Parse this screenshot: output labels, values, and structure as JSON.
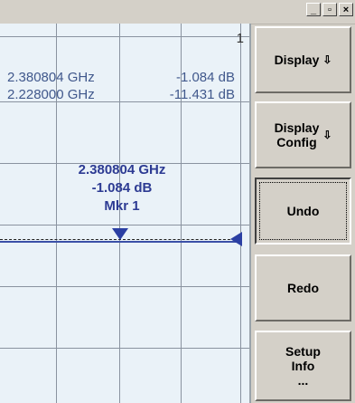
{
  "window": {
    "buttons": {
      "minimize": "_",
      "restore": "▫",
      "close": "×"
    }
  },
  "plot": {
    "trace_number": "1",
    "marker_table": [
      {
        "frequency": "2.380804 GHz",
        "level": "-1.084 dB"
      },
      {
        "frequency": "2.228000 GHz",
        "level": "-11.431 dB"
      }
    ],
    "marker_label": {
      "frequency": "2.380804 GHz",
      "level": "-1.084 dB",
      "name": "Mkr 1"
    }
  },
  "softkeys": [
    {
      "label": "Display",
      "arrow": "⇩"
    },
    {
      "label": "Display\nConfig",
      "arrow": "⇩"
    },
    {
      "label": "Undo"
    },
    {
      "label": "Redo"
    },
    {
      "label": "Setup\nInfo\n..."
    }
  ],
  "colors": {
    "plot_bg": "#eaf2f8",
    "trace": "#3b50a8",
    "marker_text": "#2d3b93",
    "grid": "#8a93a0"
  }
}
